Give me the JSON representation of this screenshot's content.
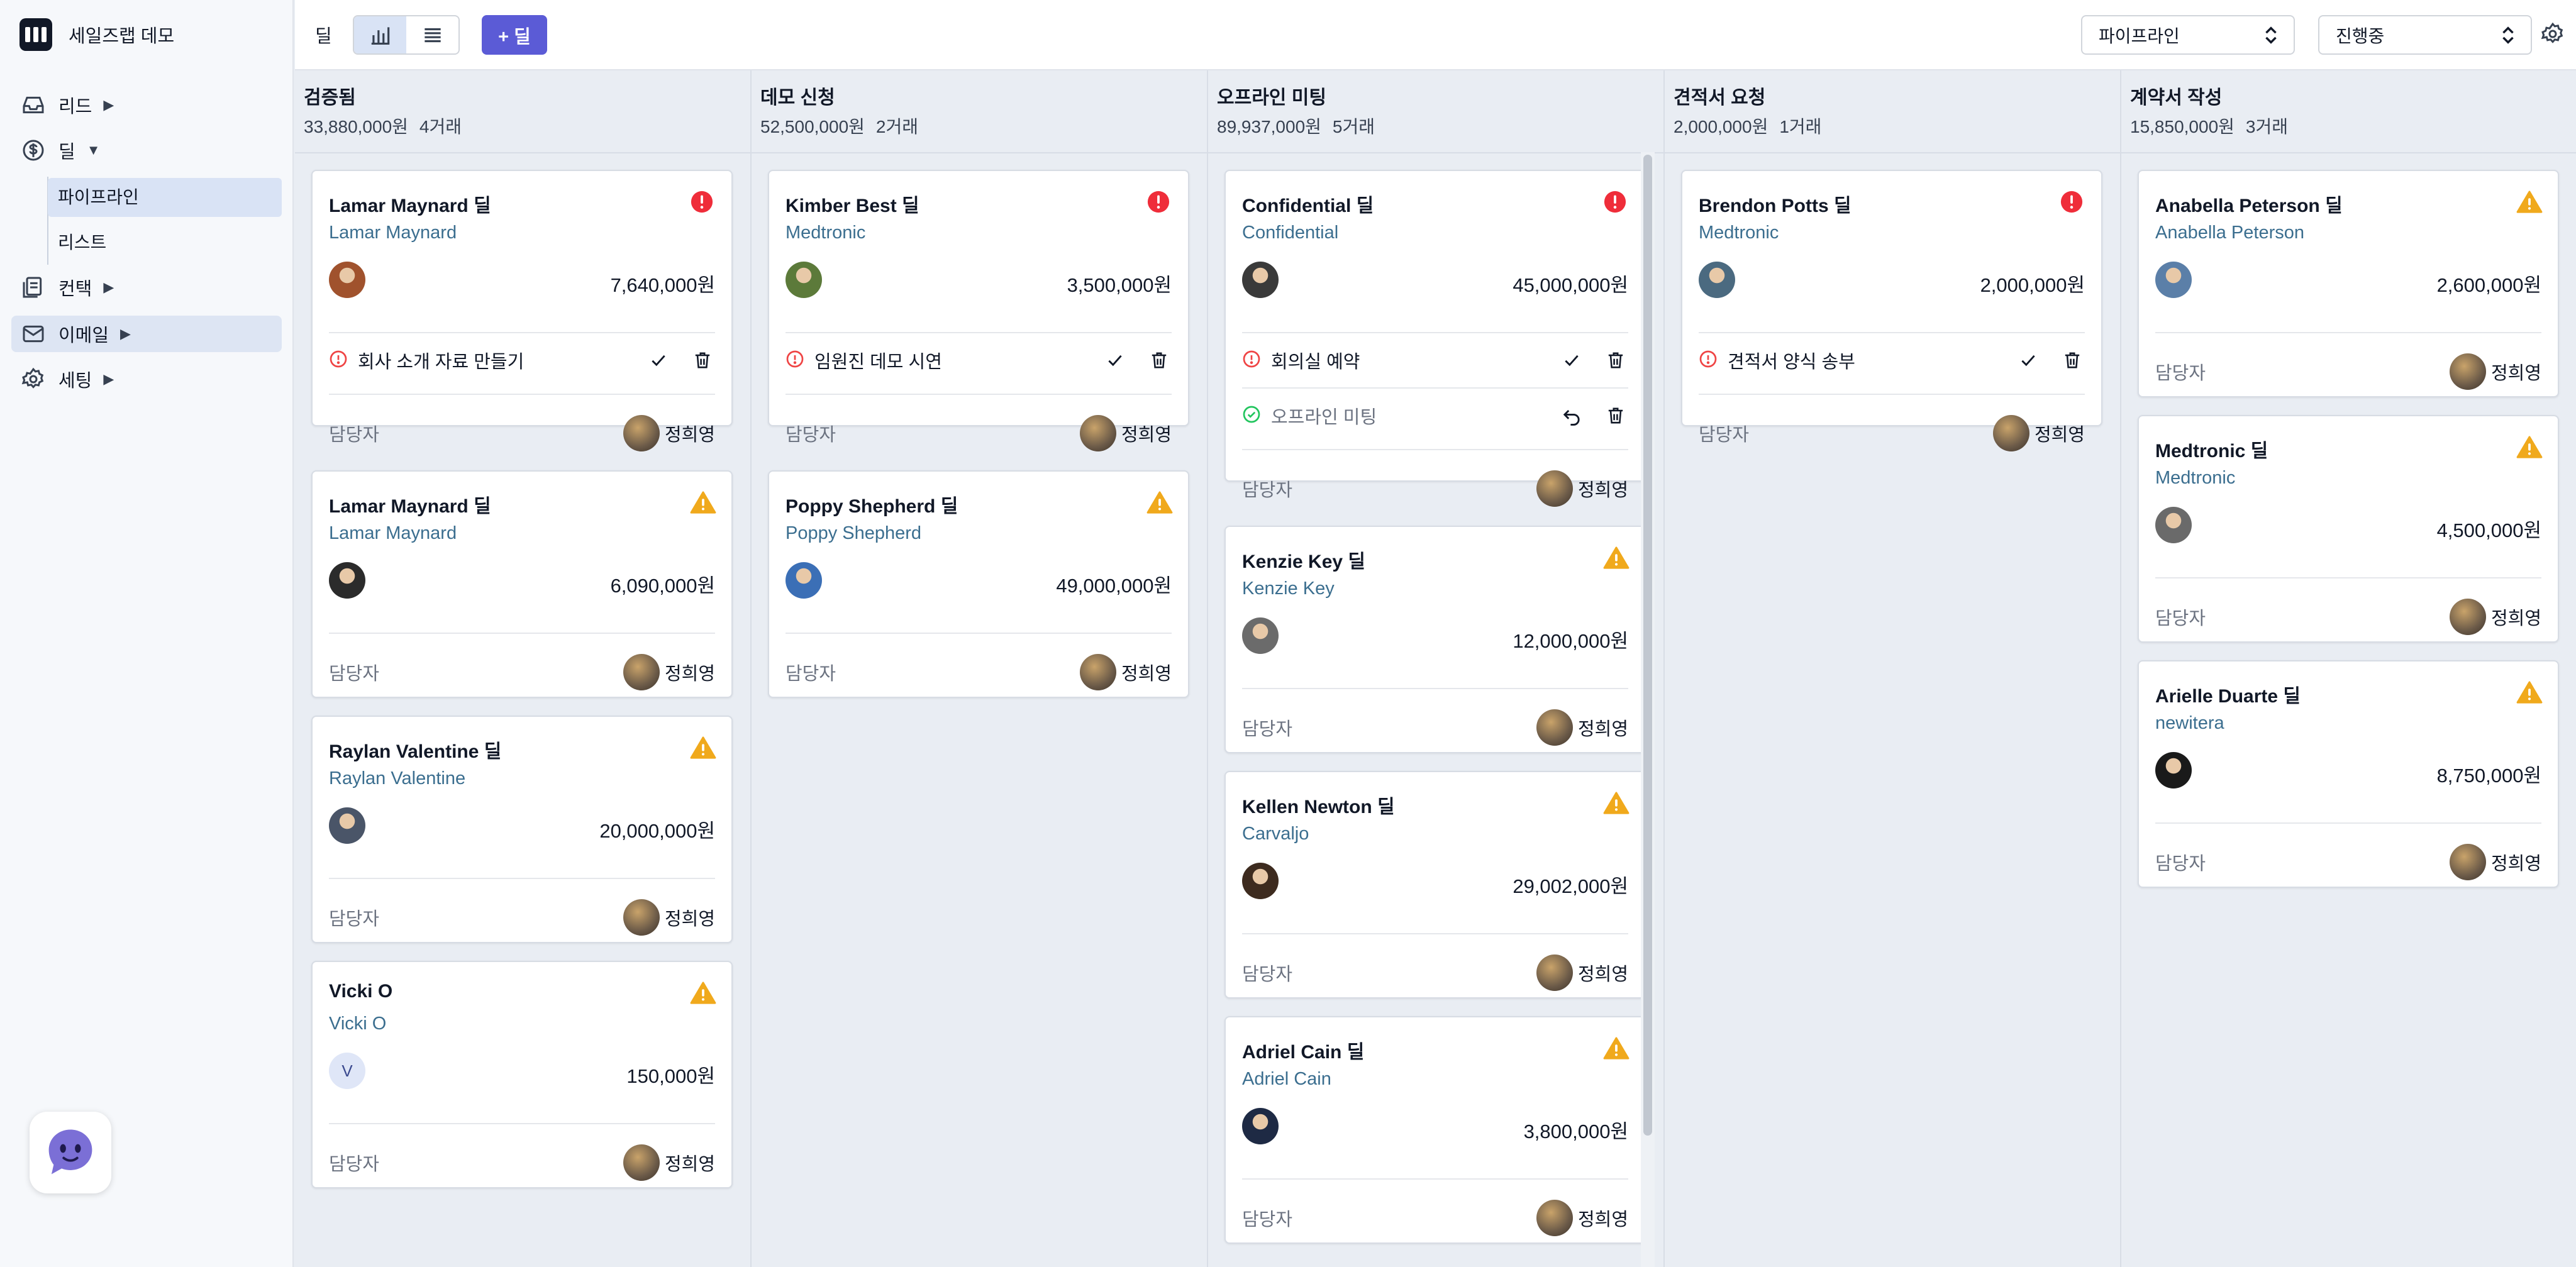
{
  "app": {
    "name": "세일즈랩 데모"
  },
  "sidebar": {
    "items": [
      {
        "label": "리드",
        "icon": "inbox-icon",
        "arrow": "▶"
      },
      {
        "label": "딜",
        "icon": "dollar-icon",
        "arrow": "▼"
      },
      {
        "label": "컨택",
        "icon": "contacts-icon",
        "arrow": "▶"
      },
      {
        "label": "이메일",
        "icon": "mail-icon",
        "arrow": "▶"
      },
      {
        "label": "세팅",
        "icon": "gear-icon",
        "arrow": "▶"
      }
    ],
    "deal_sub": [
      "파이프라인",
      "리스트"
    ]
  },
  "toolbar": {
    "view_label": "딜",
    "add_label": "+ 딜",
    "pipeline_select": "파이프라인",
    "status_select": "진행중"
  },
  "owner_label": "담당자",
  "owner_name": "정희영",
  "columns": [
    {
      "title": "검증됨",
      "total": "33,880,000원",
      "count": "4거래",
      "cards": [
        {
          "title": "Lamar Maynard 딜",
          "company": "Lamar Maynard",
          "amount": "7,640,000원",
          "status": "error",
          "avatar_color": "#a0522d",
          "tasks": [
            {
              "label": "회사 소개 자료 만들기",
              "done": false
            }
          ]
        },
        {
          "title": "Lamar Maynard 딜",
          "company": "Lamar Maynard",
          "amount": "6,090,000원",
          "status": "warning",
          "avatar_color": "#2b2b2b",
          "tasks": []
        },
        {
          "title": "Raylan Valentine 딜",
          "company": "Raylan Valentine",
          "amount": "20,000,000원",
          "status": "warning",
          "avatar_color": "#4a5568",
          "tasks": []
        },
        {
          "title": "Vicki O",
          "company": "Vicki O",
          "amount": "150,000원",
          "status": "warning",
          "avatar_initial": "V",
          "tasks": []
        }
      ]
    },
    {
      "title": "데모 신청",
      "total": "52,500,000원",
      "count": "2거래",
      "cards": [
        {
          "title": "Kimber Best 딜",
          "company": "Medtronic",
          "amount": "3,500,000원",
          "status": "error",
          "avatar_color": "#5c7a3a",
          "tasks": [
            {
              "label": "임원진 데모 시연",
              "done": false
            }
          ]
        },
        {
          "title": "Poppy Shepherd 딜",
          "company": "Poppy Shepherd",
          "amount": "49,000,000원",
          "status": "warning",
          "avatar_color": "#3b6fb6",
          "tasks": []
        }
      ]
    },
    {
      "title": "오프라인 미팅",
      "total": "89,937,000원",
      "count": "5거래",
      "cards": [
        {
          "title": "Confidential 딜",
          "company": "Confidential",
          "amount": "45,000,000원",
          "status": "error",
          "avatar_color": "#3a3a3a",
          "tasks": [
            {
              "label": "회의실 예약",
              "done": false
            },
            {
              "label": "오프라인 미팅",
              "done": true
            }
          ]
        },
        {
          "title": "Kenzie Key 딜",
          "company": "Kenzie Key",
          "amount": "12,000,000원",
          "status": "warning",
          "avatar_color": "#6b6b6b",
          "tasks": []
        },
        {
          "title": "Kellen Newton 딜",
          "company": "Carvaljo",
          "amount": "29,002,000원",
          "status": "warning",
          "avatar_color": "#3d2b1f",
          "tasks": []
        },
        {
          "title": "Adriel Cain 딜",
          "company": "Adriel Cain",
          "amount": "3,800,000원",
          "status": "warning",
          "avatar_color": "#1e2a44",
          "tasks": []
        }
      ]
    },
    {
      "title": "견적서 요청",
      "total": "2,000,000원",
      "count": "1거래",
      "cards": [
        {
          "title": "Brendon Potts 딜",
          "company": "Medtronic",
          "amount": "2,000,000원",
          "status": "error",
          "avatar_color": "#4b6a80",
          "tasks": [
            {
              "label": "견적서 양식 송부",
              "done": false
            }
          ]
        }
      ]
    },
    {
      "title": "계약서 작성",
      "total": "15,850,000원",
      "count": "3거래",
      "cards": [
        {
          "title": "Anabella Peterson 딜",
          "company": "Anabella Peterson",
          "amount": "2,600,000원",
          "status": "warning",
          "avatar_color": "#5b7fa8",
          "tasks": []
        },
        {
          "title": "Medtronic 딜",
          "company": "Medtronic",
          "amount": "4,500,000원",
          "status": "warning",
          "avatar_color": "#6a6a6a",
          "tasks": []
        },
        {
          "title": "Arielle Duarte 딜",
          "company": "newitera",
          "amount": "8,750,000원",
          "status": "warning",
          "avatar_color": "#1a1a1a",
          "tasks": []
        }
      ]
    }
  ],
  "colors": {
    "accent": "#5b5bd6",
    "error": "#ef2d3a",
    "warning": "#f0a91c",
    "company": "#3b6e8f"
  }
}
